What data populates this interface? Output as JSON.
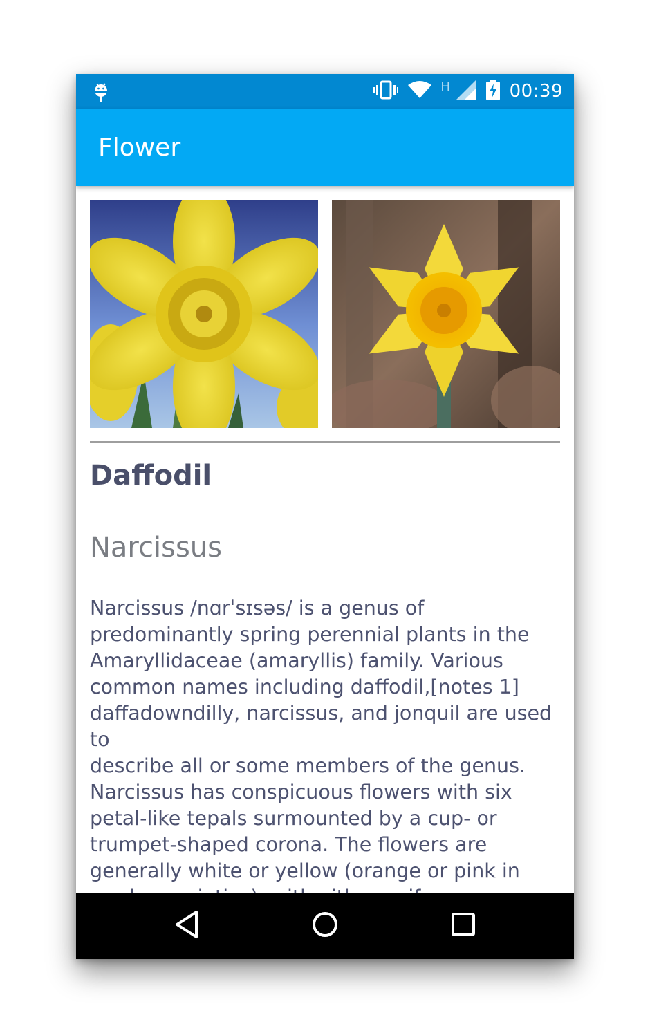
{
  "status_bar": {
    "time": "00:39",
    "network_label": "H",
    "icons": [
      "android-debug-icon",
      "vibrate-icon",
      "wifi-icon",
      "cell-signal-icon",
      "battery-charging-icon"
    ]
  },
  "app_bar": {
    "title": "Flower"
  },
  "photos": [
    {
      "name": "daffodil-photo-sky",
      "alt": "daffodil"
    },
    {
      "name": "daffodil-photo-forest",
      "alt": "daffodil"
    }
  ],
  "flower": {
    "name": "Daffodil",
    "latin": "Narcissus",
    "description": "Narcissus /nɑrˈsɪsəs/ is a genus of\npredominantly spring perennial plants in the\nAmaryllidaceae (amaryllis) family. Various\ncommon names including daffodil,[notes 1]\ndaffadowndilly, narcissus, and jonquil are used to\ndescribe all or some members of the genus.\nNarcissus has conspicuous flowers with six\npetal-like tepals surmounted by a cup- or\ntrumpet-shaped corona. The flowers are\ngenerally white or yellow (orange or pink in\ngarden varieties), with either uniform or\ncontrasting coloured tepals and corona."
  },
  "nav_bar": {
    "icons": [
      "back-icon",
      "home-icon",
      "recents-icon"
    ]
  },
  "colors": {
    "status_bar": "#0288d1",
    "app_bar": "#03a9f4",
    "heading_text": "#4a4f6a",
    "subheading_text": "#7a7d83",
    "body_text": "#4d5270"
  }
}
